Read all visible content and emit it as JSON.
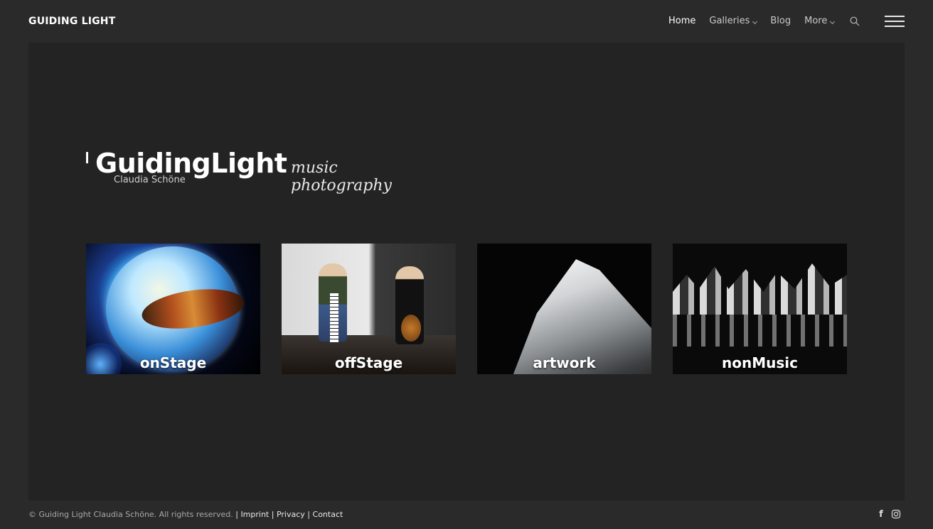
{
  "header": {
    "brand": "GUIDING LIGHT",
    "nav": [
      {
        "label": "Home",
        "active": true
      },
      {
        "label": "Galleries",
        "dropdown": true
      },
      {
        "label": "Blog"
      },
      {
        "label": "More",
        "dropdown": true
      }
    ],
    "search_icon": "search-icon",
    "menu_icon": "hamburger-menu-icon"
  },
  "logo": {
    "name": "GuidingLight",
    "subtitle": "Claudia Schöne",
    "tagline": "music photography"
  },
  "tiles": [
    {
      "label": "onStage"
    },
    {
      "label": "offStage"
    },
    {
      "label": "artwork"
    },
    {
      "label": "nonMusic"
    }
  ],
  "footer": {
    "copyright": "© Guiding Light Claudia Schöne. All rights reserved.",
    "separator": "|",
    "links": [
      "Imprint",
      "Privacy",
      "Contact"
    ],
    "social": [
      "facebook-icon",
      "instagram-icon"
    ]
  },
  "colors": {
    "page_bg": "#2a2a2b",
    "content_bg": "#232324",
    "text_active": "#ffffff",
    "text_nav": "#c9c9c9"
  }
}
